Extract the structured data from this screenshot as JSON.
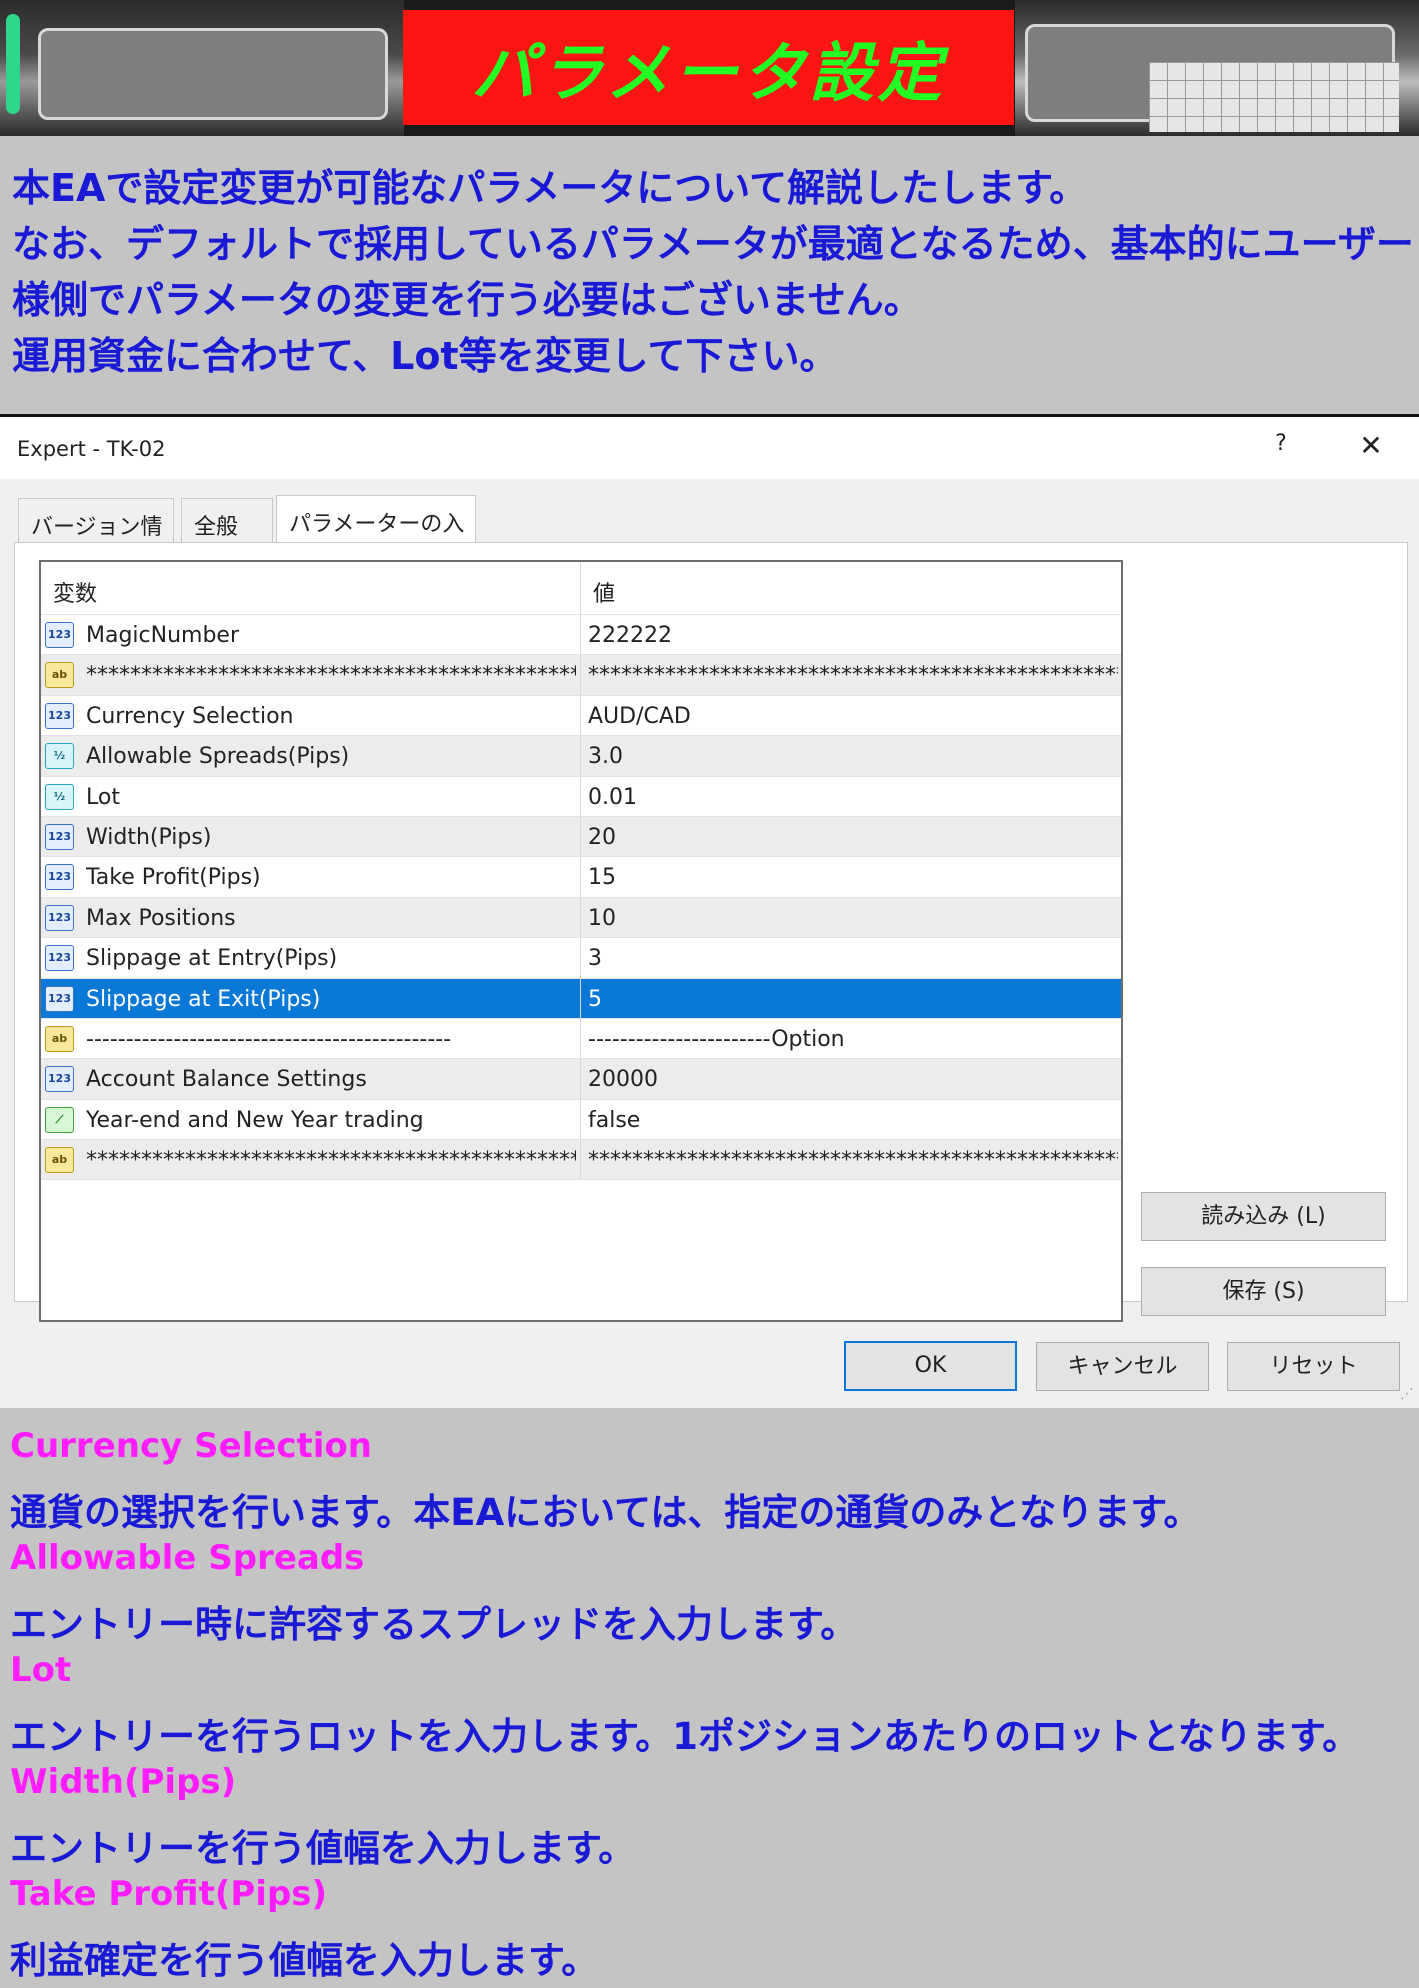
{
  "banner": {
    "title": "パラメータ設定"
  },
  "intro": {
    "lines": [
      "本EAで設定変更が可能なパラメータについて解説したします。",
      "なお、デフォルトで採用しているパラメータが最適となるため、基本的にユーザー",
      "様側でパラメータの変更を行う必要はございません。",
      "運用資金に合わせて、Lot等を変更して下さい。"
    ]
  },
  "dialog": {
    "title": "Expert - TK-02",
    "help": "?",
    "close": "✕",
    "tabs": [
      "バージョン情報",
      "全般",
      "パラメーターの入力"
    ],
    "table": {
      "col_variable": "変数",
      "col_value": "値",
      "rows": [
        {
          "icon": "123",
          "name": "MagicNumber",
          "value": "222222"
        },
        {
          "icon": "ab",
          "name": "**********************************************",
          "value": "*****************************************************"
        },
        {
          "icon": "123",
          "name": "Currency Selection",
          "value": "AUD/CAD"
        },
        {
          "icon": "½",
          "name": "Allowable Spreads(Pips)",
          "value": "3.0"
        },
        {
          "icon": "½",
          "name": "Lot",
          "value": "0.01"
        },
        {
          "icon": "123",
          "name": "Width(Pips)",
          "value": "20"
        },
        {
          "icon": "123",
          "name": "Take Profit(Pips)",
          "value": "15"
        },
        {
          "icon": "123",
          "name": "Max Positions",
          "value": "10"
        },
        {
          "icon": "123",
          "name": "Slippage at Entry(Pips)",
          "value": "3"
        },
        {
          "icon": "123",
          "name": "Slippage at Exit(Pips)",
          "value": "5"
        },
        {
          "icon": "ab",
          "name": "----------------------------------------------",
          "value": "-----------------------Option"
        },
        {
          "icon": "123",
          "name": "Account Balance Settings",
          "value": "20000"
        },
        {
          "icon": "⟋",
          "name": "Year-end and New Year trading",
          "value": "false"
        },
        {
          "icon": "ab",
          "name": "**********************************************",
          "value": "*****************************************************"
        }
      ]
    },
    "buttons": {
      "load": "読み込み (L)",
      "save": "保存 (S)",
      "ok": "OK",
      "cancel": "キャンセル",
      "reset": "リセット"
    }
  },
  "descriptions": [
    {
      "heading": "Currency Selection",
      "body": "通貨の選択を行います。本EAにおいては、指定の通貨のみとなります。"
    },
    {
      "heading": "Allowable Spreads",
      "body": "エントリー時に許容するスプレッドを入力します。"
    },
    {
      "heading": "Lot",
      "body": "エントリーを行うロットを入力します。1ポジションあたりのロットとなります。"
    },
    {
      "heading": "Width(Pips)",
      "body": "エントリーを行う値幅を入力します。"
    },
    {
      "heading": "Take Profit(Pips)",
      "body": "利益確定を行う値幅を入力します。"
    }
  ]
}
